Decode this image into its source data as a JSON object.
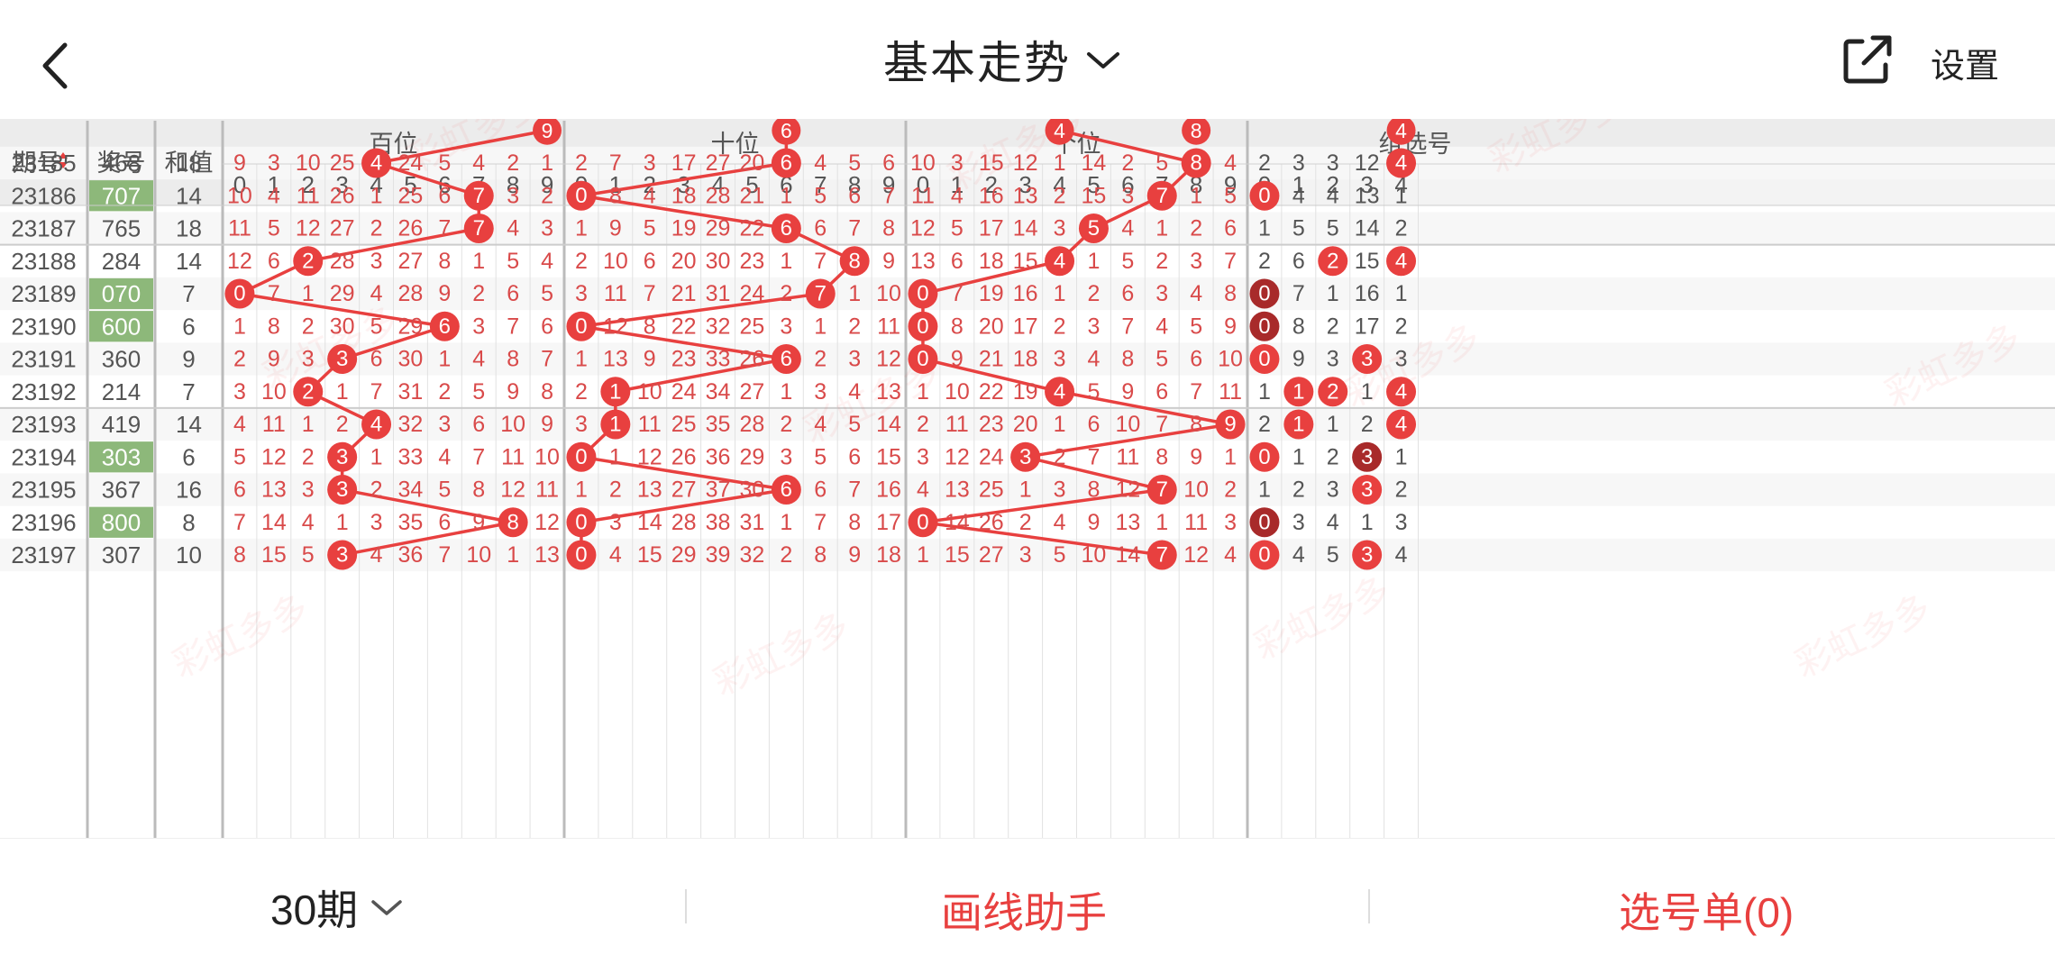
{
  "header": {
    "title": "基本走势",
    "settings_label": "设置"
  },
  "footer": {
    "period_label": "30期",
    "draw_helper_label": "画线助手",
    "selection_label": "选号单(0)"
  },
  "watermark": "彩虹多多",
  "colors": {
    "accent": "#e8403f",
    "dark_ball": "#a82a2a",
    "highlight_cell": "#8db87a",
    "miss_text": "#d94a4a",
    "header_bg": "#ececec"
  },
  "table": {
    "headers": {
      "issue": "期号",
      "number": "奖号",
      "sum": "和值",
      "groups": [
        "百位",
        "十位",
        "个位",
        "组选号"
      ],
      "digits": [
        "0",
        "1",
        "2",
        "3",
        "4",
        "5",
        "6",
        "7",
        "8",
        "9"
      ],
      "group_digits": [
        "0",
        "1",
        "2",
        "3",
        "4"
      ]
    },
    "partial_top_row": {
      "b": [
        null,
        null,
        null,
        null,
        null,
        null,
        null,
        null,
        null,
        "9"
      ],
      "s": [
        null,
        null,
        null,
        null,
        null,
        null,
        "6",
        null,
        null,
        null
      ],
      "g": [
        null,
        null,
        null,
        null,
        "4",
        null,
        null,
        null,
        "8",
        null
      ],
      "z": [
        null,
        null,
        null,
        null,
        "4"
      ]
    },
    "rows": [
      {
        "issue": "23185",
        "num": "468",
        "sum": "18",
        "hl": false,
        "b": [
          "9",
          "3",
          "10",
          "25",
          "4",
          "24",
          "5",
          "4",
          "2",
          "1"
        ],
        "bh": 4,
        "s": [
          "2",
          "7",
          "3",
          "17",
          "27",
          "20",
          "6",
          "4",
          "5",
          "6"
        ],
        "sh": 6,
        "g": [
          "10",
          "3",
          "15",
          "12",
          "1",
          "14",
          "2",
          "5",
          "8",
          "4"
        ],
        "gh": 8,
        "z": [
          "2",
          "3",
          "3",
          "12",
          "4"
        ],
        "zh": [
          4
        ],
        "zd": []
      },
      {
        "issue": "23186",
        "num": "707",
        "sum": "14",
        "hl": true,
        "b": [
          "10",
          "4",
          "11",
          "26",
          "1",
          "25",
          "6",
          "7",
          "3",
          "2"
        ],
        "bh": 7,
        "s": [
          "0",
          "8",
          "4",
          "18",
          "28",
          "21",
          "1",
          "5",
          "6",
          "7"
        ],
        "sh": 0,
        "g": [
          "11",
          "4",
          "16",
          "13",
          "2",
          "15",
          "3",
          "7",
          "1",
          "5"
        ],
        "gh": 7,
        "z": [
          "0",
          "4",
          "4",
          "13",
          "1"
        ],
        "zh": [
          0
        ],
        "zd": []
      },
      {
        "issue": "23187",
        "num": "765",
        "sum": "18",
        "hl": false,
        "b": [
          "11",
          "5",
          "12",
          "27",
          "2",
          "26",
          "7",
          "7",
          "4",
          "3"
        ],
        "bh": 7,
        "s": [
          "1",
          "9",
          "5",
          "19",
          "29",
          "22",
          "6",
          "6",
          "7",
          "8"
        ],
        "sh": 6,
        "g": [
          "12",
          "5",
          "17",
          "14",
          "3",
          "5",
          "4",
          "1",
          "2",
          "6"
        ],
        "gh": 5,
        "z": [
          "1",
          "5",
          "5",
          "14",
          "2"
        ],
        "zh": [],
        "zd": []
      },
      {
        "issue": "23188",
        "num": "284",
        "sum": "14",
        "hl": false,
        "b": [
          "12",
          "6",
          "2",
          "28",
          "3",
          "27",
          "8",
          "1",
          "5",
          "4"
        ],
        "bh": 2,
        "s": [
          "2",
          "10",
          "6",
          "20",
          "30",
          "23",
          "1",
          "7",
          "8",
          "9"
        ],
        "sh": 8,
        "g": [
          "13",
          "6",
          "18",
          "15",
          "4",
          "1",
          "5",
          "2",
          "3",
          "7"
        ],
        "gh": 4,
        "z": [
          "2",
          "6",
          "2",
          "15",
          "4"
        ],
        "zh": [
          2,
          4
        ],
        "zd": []
      },
      {
        "issue": "23189",
        "num": "070",
        "sum": "7",
        "hl": true,
        "b": [
          "0",
          "7",
          "1",
          "29",
          "4",
          "28",
          "9",
          "2",
          "6",
          "5"
        ],
        "bh": 0,
        "s": [
          "3",
          "11",
          "7",
          "21",
          "31",
          "24",
          "2",
          "7",
          "1",
          "10"
        ],
        "sh": 7,
        "g": [
          "0",
          "7",
          "19",
          "16",
          "1",
          "2",
          "6",
          "3",
          "4",
          "8"
        ],
        "gh": 0,
        "z": [
          "0",
          "7",
          "1",
          "16",
          "1"
        ],
        "zh": [],
        "zd": [
          0
        ]
      },
      {
        "issue": "23190",
        "num": "600",
        "sum": "6",
        "hl": true,
        "b": [
          "1",
          "8",
          "2",
          "30",
          "5",
          "29",
          "6",
          "3",
          "7",
          "6"
        ],
        "bh": 6,
        "s": [
          "0",
          "12",
          "8",
          "22",
          "32",
          "25",
          "3",
          "1",
          "2",
          "11"
        ],
        "sh": 0,
        "g": [
          "0",
          "8",
          "20",
          "17",
          "2",
          "3",
          "7",
          "4",
          "5",
          "9"
        ],
        "gh": 0,
        "z": [
          "0",
          "8",
          "2",
          "17",
          "2"
        ],
        "zh": [],
        "zd": [
          0
        ]
      },
      {
        "issue": "23191",
        "num": "360",
        "sum": "9",
        "hl": false,
        "b": [
          "2",
          "9",
          "3",
          "3",
          "6",
          "30",
          "1",
          "4",
          "8",
          "7"
        ],
        "bh": 3,
        "s": [
          "1",
          "13",
          "9",
          "23",
          "33",
          "26",
          "6",
          "2",
          "3",
          "12"
        ],
        "sh": 6,
        "g": [
          "0",
          "9",
          "21",
          "18",
          "3",
          "4",
          "8",
          "5",
          "6",
          "10"
        ],
        "gh": 0,
        "z": [
          "0",
          "9",
          "3",
          "3",
          "3"
        ],
        "zh": [
          0,
          3
        ],
        "zd": []
      },
      {
        "issue": "23192",
        "num": "214",
        "sum": "7",
        "hl": false,
        "b": [
          "3",
          "10",
          "2",
          "1",
          "7",
          "31",
          "2",
          "5",
          "9",
          "8"
        ],
        "bh": 2,
        "s": [
          "2",
          "1",
          "10",
          "24",
          "34",
          "27",
          "1",
          "3",
          "4",
          "13"
        ],
        "sh": 1,
        "g": [
          "1",
          "10",
          "22",
          "19",
          "4",
          "5",
          "9",
          "6",
          "7",
          "11"
        ],
        "gh": 4,
        "z": [
          "1",
          "1",
          "2",
          "1",
          "4"
        ],
        "zh": [
          1,
          2,
          4
        ],
        "zd": []
      },
      {
        "issue": "23193",
        "num": "419",
        "sum": "14",
        "hl": false,
        "b": [
          "4",
          "11",
          "1",
          "2",
          "4",
          "32",
          "3",
          "6",
          "10",
          "9"
        ],
        "bh": 4,
        "s": [
          "3",
          "1",
          "11",
          "25",
          "35",
          "28",
          "2",
          "4",
          "5",
          "14"
        ],
        "sh": 1,
        "g": [
          "2",
          "11",
          "23",
          "20",
          "1",
          "6",
          "10",
          "7",
          "8",
          "9"
        ],
        "gh": 9,
        "z": [
          "2",
          "1",
          "1",
          "2",
          "4"
        ],
        "zh": [
          1,
          4
        ],
        "zd": []
      },
      {
        "issue": "23194",
        "num": "303",
        "sum": "6",
        "hl": true,
        "b": [
          "5",
          "12",
          "2",
          "3",
          "1",
          "33",
          "4",
          "7",
          "11",
          "10"
        ],
        "bh": 3,
        "s": [
          "0",
          "1",
          "12",
          "26",
          "36",
          "29",
          "3",
          "5",
          "6",
          "15"
        ],
        "sh": 0,
        "g": [
          "3",
          "12",
          "24",
          "3",
          "2",
          "7",
          "11",
          "8",
          "9",
          "1"
        ],
        "gh": 3,
        "z": [
          "0",
          "1",
          "2",
          "3",
          "1"
        ],
        "zh": [
          0
        ],
        "zd": [
          3
        ]
      },
      {
        "issue": "23195",
        "num": "367",
        "sum": "16",
        "hl": false,
        "b": [
          "6",
          "13",
          "3",
          "3",
          "2",
          "34",
          "5",
          "8",
          "12",
          "11"
        ],
        "bh": 3,
        "s": [
          "1",
          "2",
          "13",
          "27",
          "37",
          "30",
          "6",
          "6",
          "7",
          "16"
        ],
        "sh": 6,
        "g": [
          "4",
          "13",
          "25",
          "1",
          "3",
          "8",
          "12",
          "7",
          "10",
          "2"
        ],
        "gh": 7,
        "z": [
          "1",
          "2",
          "3",
          "3",
          "2"
        ],
        "zh": [
          3
        ],
        "zd": []
      },
      {
        "issue": "23196",
        "num": "800",
        "sum": "8",
        "hl": true,
        "b": [
          "7",
          "14",
          "4",
          "1",
          "3",
          "35",
          "6",
          "9",
          "8",
          "12"
        ],
        "bh": 8,
        "s": [
          "0",
          "3",
          "14",
          "28",
          "38",
          "31",
          "1",
          "7",
          "8",
          "17"
        ],
        "sh": 0,
        "g": [
          "0",
          "14",
          "26",
          "2",
          "4",
          "9",
          "13",
          "1",
          "11",
          "3"
        ],
        "gh": 0,
        "z": [
          "0",
          "3",
          "4",
          "1",
          "3"
        ],
        "zh": [],
        "zd": [
          0
        ]
      },
      {
        "issue": "23197",
        "num": "307",
        "sum": "10",
        "hl": false,
        "b": [
          "8",
          "15",
          "5",
          "3",
          "4",
          "36",
          "7",
          "10",
          "1",
          "13"
        ],
        "bh": 3,
        "s": [
          "0",
          "4",
          "15",
          "29",
          "39",
          "32",
          "2",
          "8",
          "9",
          "18"
        ],
        "sh": 0,
        "g": [
          "1",
          "15",
          "27",
          "3",
          "5",
          "10",
          "14",
          "7",
          "12",
          "4"
        ],
        "gh": 7,
        "z": [
          "0",
          "4",
          "5",
          "3",
          "4"
        ],
        "zh": [
          0,
          3
        ],
        "zd": []
      }
    ]
  }
}
